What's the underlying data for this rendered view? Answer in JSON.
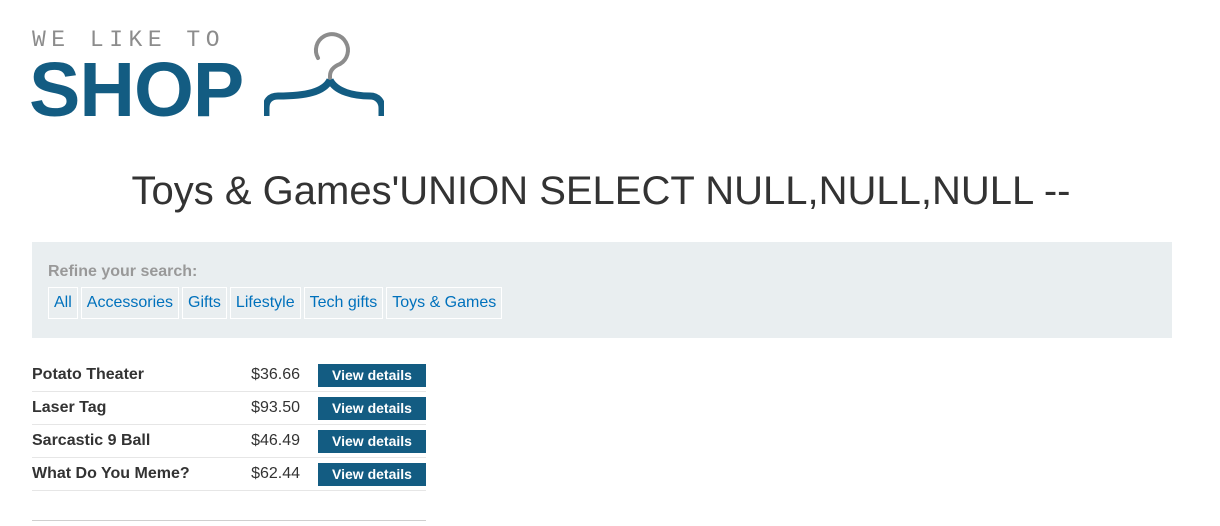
{
  "logo": {
    "tagline": "WE LIKE TO",
    "wordmark": "SHOP",
    "icon": "hanger-icon",
    "colors": {
      "tagline": "#8c8c8c",
      "wordmark": "#135c82"
    }
  },
  "page_title": "Toys & Games'UNION SELECT NULL,NULL,NULL --",
  "filters": {
    "label": "Refine your search:",
    "items": [
      {
        "label": "All"
      },
      {
        "label": "Accessories"
      },
      {
        "label": "Gifts"
      },
      {
        "label": "Lifestyle"
      },
      {
        "label": "Tech gifts"
      },
      {
        "label": "Toys & Games"
      }
    ]
  },
  "products": [
    {
      "name": "Potato Theater",
      "price": "$36.66",
      "action": "View details"
    },
    {
      "name": "Laser Tag",
      "price": "$93.50",
      "action": "View details"
    },
    {
      "name": "Sarcastic 9 Ball",
      "price": "$46.49",
      "action": "View details"
    },
    {
      "name": "What Do You Meme?",
      "price": "$62.44",
      "action": "View details"
    }
  ],
  "colors": {
    "accent": "#135c82",
    "link": "#0071bc",
    "panel_bg": "#e9eef0"
  }
}
